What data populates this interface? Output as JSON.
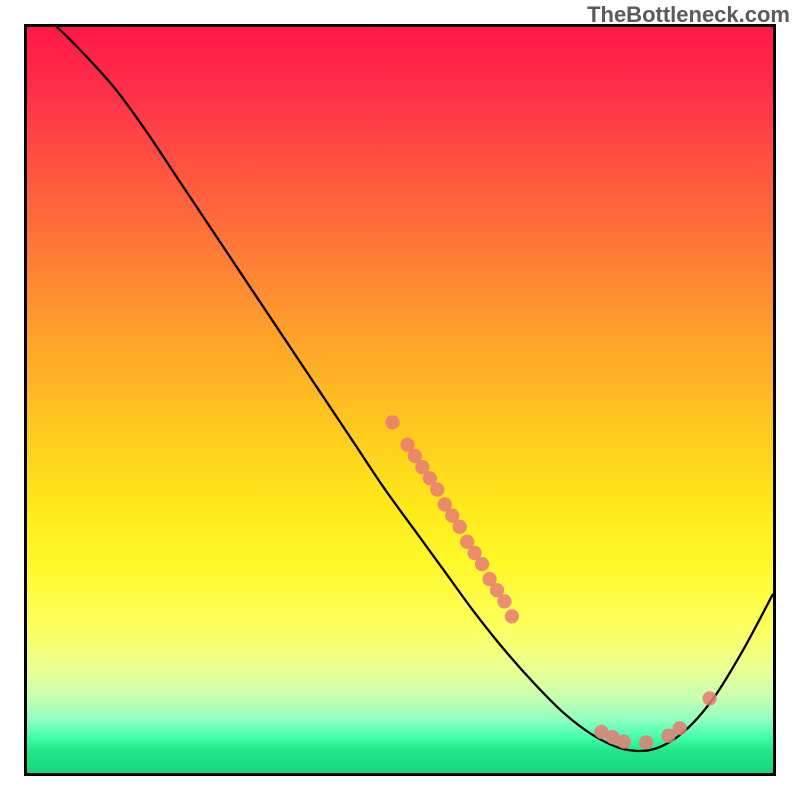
{
  "watermark": "TheBottleneck.com",
  "chart_data": {
    "type": "line",
    "title": "",
    "xlabel": "",
    "ylabel": "",
    "xlim": [
      0,
      100
    ],
    "ylim": [
      0,
      100
    ],
    "grid": false,
    "legend": false,
    "series": [
      {
        "name": "curve",
        "x": [
          0,
          4,
          8,
          12,
          16,
          20,
          24,
          28,
          32,
          36,
          40,
          44,
          48,
          52,
          56,
          60,
          64,
          68,
          72,
          76,
          80,
          84,
          88,
          92,
          96,
          100
        ],
        "y": [
          103,
          100,
          96,
          91.5,
          86,
          80,
          74,
          68,
          62,
          56,
          50,
          44,
          38,
          32.5,
          27,
          21.5,
          16.5,
          12,
          8,
          5,
          3.2,
          3.2,
          5.5,
          10,
          16.5,
          24
        ]
      }
    ],
    "points": [
      {
        "x": 49,
        "y": 47
      },
      {
        "x": 51,
        "y": 44
      },
      {
        "x": 52,
        "y": 42.5
      },
      {
        "x": 53,
        "y": 41
      },
      {
        "x": 54,
        "y": 39.5
      },
      {
        "x": 55,
        "y": 38
      },
      {
        "x": 56,
        "y": 36
      },
      {
        "x": 57,
        "y": 34.5
      },
      {
        "x": 58,
        "y": 33
      },
      {
        "x": 59,
        "y": 31
      },
      {
        "x": 60,
        "y": 29.5
      },
      {
        "x": 61,
        "y": 28
      },
      {
        "x": 62,
        "y": 26
      },
      {
        "x": 63,
        "y": 24.5
      },
      {
        "x": 64,
        "y": 23
      },
      {
        "x": 65,
        "y": 21
      },
      {
        "x": 77,
        "y": 5.5
      },
      {
        "x": 78.5,
        "y": 4.8
      },
      {
        "x": 80,
        "y": 4.2
      },
      {
        "x": 83,
        "y": 4.1
      },
      {
        "x": 86,
        "y": 5
      },
      {
        "x": 87.5,
        "y": 6
      },
      {
        "x": 91.5,
        "y": 10
      }
    ],
    "background": "rainbow-vertical-gradient"
  }
}
